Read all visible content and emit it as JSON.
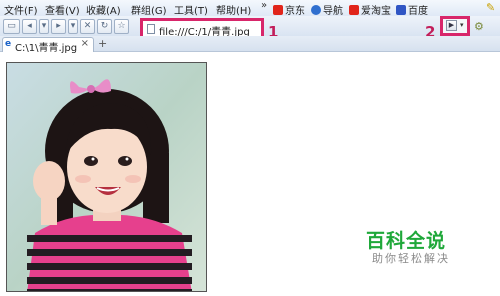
{
  "menu": {
    "items": [
      "文件(F)",
      "查看(V)",
      "收藏(A)",
      "群组(G)",
      "工具(T)",
      "帮助(H)"
    ],
    "more_chevron": "»",
    "bookmarks": [
      {
        "label": "京东",
        "icon": "jd-icon",
        "color": "#e1251b"
      },
      {
        "label": "导航",
        "icon": "globe-icon",
        "color": "#2f6fcf"
      },
      {
        "label": "爱淘宝",
        "icon": "taobao-icon",
        "color": "#e1251b"
      },
      {
        "label": "百度",
        "icon": "baidu-icon",
        "color": "#2f55c4"
      }
    ]
  },
  "toolbar": {
    "address_url": "file:///C:/1/青青.jpg",
    "annotation_1": "1",
    "annotation_2": "2"
  },
  "tab": {
    "title": "C:\\1\\青青.jpg",
    "close": "×",
    "new_tab": "+"
  },
  "watermark": {
    "title": "百科全说",
    "subtitle": "助你轻松解决"
  },
  "colors": {
    "highlight_box": "#d8266a",
    "watermark_green": "#1fa83a"
  }
}
